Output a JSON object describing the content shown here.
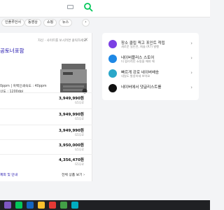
{
  "search": {
    "kbd_label": "⌨"
  },
  "tabs": [
    {
      "label": "인플루언서"
    },
    {
      "label": "동영상"
    },
    {
      "label": "쇼핑"
    },
    {
      "label": "뉴스"
    }
  ],
  "tab_more": "›",
  "main_card": {
    "top_note": "자신 · 사이트를 보시려면 클릭하세요",
    "close": "✕",
    "title": "공토너포함",
    "specs": [
      "0ppm | 흑백인쇄속도 : 40ppm",
      "상도 : 1200dpi"
    ],
    "prices": [
      {
        "price": "3,949,990원",
        "ship": "G5무료"
      },
      {
        "price": "3,949,990원",
        "ship": "G5무료"
      },
      {
        "price": "3,949,990원",
        "ship": "G5무료"
      },
      {
        "price": "3,950,000원",
        "ship": "G5무료"
      },
      {
        "price": "4,356,470원",
        "ship": "G5무료"
      }
    ],
    "footer_left": "제외 및 안내",
    "footer_right": "전체 상품 보기 ›"
  },
  "side_items": [
    {
      "title": "장소 클립 찍고 포인트 적립",
      "sub": "새로운 일인전, 최솔 (R7) 발행",
      "icon_color": "#7b3fe4"
    },
    {
      "title": "네이버플러스 스토어",
      "sub": "더 합리적인 쇼핑을 해야 해",
      "icon_color": "#1e88e5"
    },
    {
      "title": "빠르게 강로 네이버배송",
      "sub": "내일도 발송하세 보아요",
      "icon_color": "#2aa7c9"
    },
    {
      "title": "네이버에서 댓글리스트를",
      "sub": "",
      "icon_color": "#111111"
    }
  ],
  "side_arrow": "›",
  "colors": {
    "accent_green": "#03c75a",
    "link_blue": "#1a0dab"
  }
}
